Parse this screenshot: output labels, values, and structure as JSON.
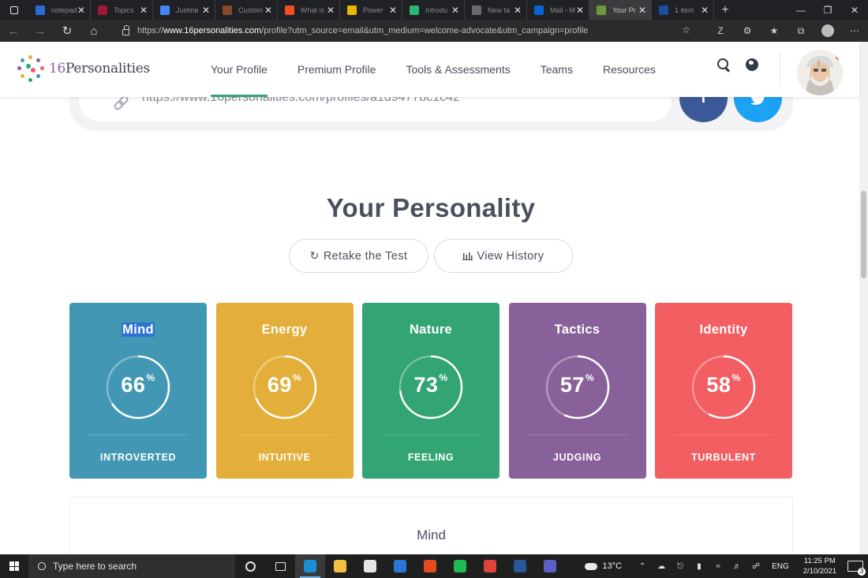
{
  "browser": {
    "tabs": [
      {
        "title": "notepad",
        "icon": "bing-icon",
        "color": "#2a6cd4"
      },
      {
        "title": "Topics",
        "icon": "topics-icon",
        "color": "#a0193a"
      },
      {
        "title": "Justine",
        "icon": "google-icon",
        "color": "#4285f4"
      },
      {
        "title": "Custom",
        "icon": "custom-icon",
        "color": "#8a4a2a"
      },
      {
        "title": "What is",
        "icon": "microsoft-icon",
        "color": "#f25022"
      },
      {
        "title": "Power",
        "icon": "power-icon",
        "color": "#e8b800"
      },
      {
        "title": "Introdu",
        "icon": "intro-icon",
        "color": "#2bb673"
      },
      {
        "title": "New ta",
        "icon": "newtab-icon",
        "color": "#6b6b6b"
      },
      {
        "title": "Mail - M",
        "icon": "outlook-icon",
        "color": "#0a64d2"
      },
      {
        "title": "Your Pr",
        "icon": "16p-icon",
        "color": "#6a9a3a",
        "active": true
      },
      {
        "title": "1 item",
        "icon": "s-icon",
        "color": "#1a4ea0"
      }
    ],
    "url_domain": "www.16personalities.com",
    "url_rest": "/profile?utm_source=email&utm_medium=welcome-advocate&utm_campaign=profile"
  },
  "site": {
    "logo_number": "16",
    "logo_word": "Personalities",
    "nav": [
      "Your Profile",
      "Premium Profile",
      "Tools & Assessments",
      "Teams",
      "Resources"
    ],
    "active_nav": 0
  },
  "share": {
    "profile_url": "https://www.16personalities.com/profiles/a1d9477bc1c42",
    "facebook_glyph": "f"
  },
  "personality": {
    "title": "Your Personality",
    "retake_label": "Retake the Test",
    "history_label": "View History",
    "percent_symbol": "%",
    "traits": [
      {
        "name": "Mind",
        "percent": 66,
        "value": "INTROVERTED",
        "color": "#4298b4",
        "selected": true
      },
      {
        "name": "Energy",
        "percent": 69,
        "value": "INTUITIVE",
        "color": "#e4ae3a",
        "selected": false
      },
      {
        "name": "Nature",
        "percent": 73,
        "value": "FEELING",
        "color": "#33a474",
        "selected": false
      },
      {
        "name": "Tactics",
        "percent": 57,
        "value": "JUDGING",
        "color": "#88619a",
        "selected": false
      },
      {
        "name": "Identity",
        "percent": 58,
        "value": "TURBULENT",
        "color": "#f25e62",
        "selected": false
      }
    ]
  },
  "detail": {
    "heading": "Mind"
  },
  "taskbar": {
    "search_placeholder": "Type here to search",
    "weather": "13°C",
    "lang": "ENG",
    "time": "11:25 PM",
    "date": "2/10/2021",
    "notif_count": "3",
    "apps": [
      {
        "name": "cortana-icon",
        "color": "#1f1f1f"
      },
      {
        "name": "task-view-icon",
        "color": "#1f1f1f"
      },
      {
        "name": "edge-icon",
        "color": "#1b8fd6",
        "active": true
      },
      {
        "name": "file-explorer-icon",
        "color": "#f4c03e"
      },
      {
        "name": "store-icon",
        "color": "#e6e6e6"
      },
      {
        "name": "mail-icon",
        "color": "#2a78d6"
      },
      {
        "name": "office-icon",
        "color": "#e24a1f"
      },
      {
        "name": "spotify-icon",
        "color": "#1db954"
      },
      {
        "name": "chrome-icon",
        "color": "#db4437"
      },
      {
        "name": "word-icon",
        "color": "#2b579a"
      },
      {
        "name": "teams-icon",
        "color": "#5b5fc7"
      }
    ]
  }
}
